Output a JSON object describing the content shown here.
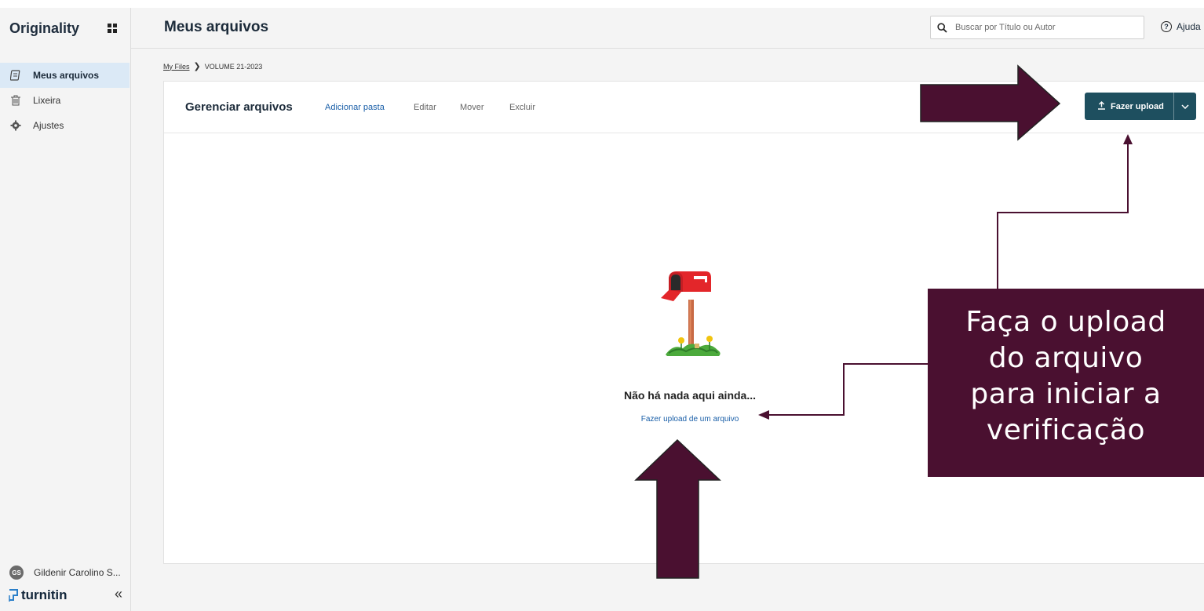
{
  "app": {
    "brand": "Originality"
  },
  "sidebar": {
    "items": [
      {
        "label": "Meus arquivos",
        "icon": "files-icon",
        "active": true
      },
      {
        "label": "Lixeira",
        "icon": "trash-icon",
        "active": false
      },
      {
        "label": "Ajustes",
        "icon": "gear-icon",
        "active": false
      }
    ],
    "user": {
      "initials": "GS",
      "name": "Gildenir Carolino S..."
    },
    "footer_logo": "turnitin",
    "collapse_label": "«"
  },
  "header": {
    "title": "Meus arquivos",
    "search_placeholder": "Buscar por Título ou Autor",
    "help_label": "Ajuda"
  },
  "breadcrumb": {
    "root": "My Files",
    "current": "VOLUME 21-2023"
  },
  "toolbar": {
    "title": "Gerenciar arquivos",
    "actions": [
      "Adicionar pasta",
      "Editar",
      "Mover",
      "Excluir"
    ],
    "upload_label": "Fazer upload"
  },
  "empty_state": {
    "title": "Não há nada aqui ainda...",
    "link": "Fazer upload de um arquivo"
  },
  "annotation": {
    "text": "Faça o  upload\ndo  arquivo\npara  iniciar a\nverificação",
    "color": "#4a1030"
  },
  "colors": {
    "primary_button": "#1e4f5f",
    "link": "#1a5fa8",
    "active_nav": "#dbe9f6"
  }
}
